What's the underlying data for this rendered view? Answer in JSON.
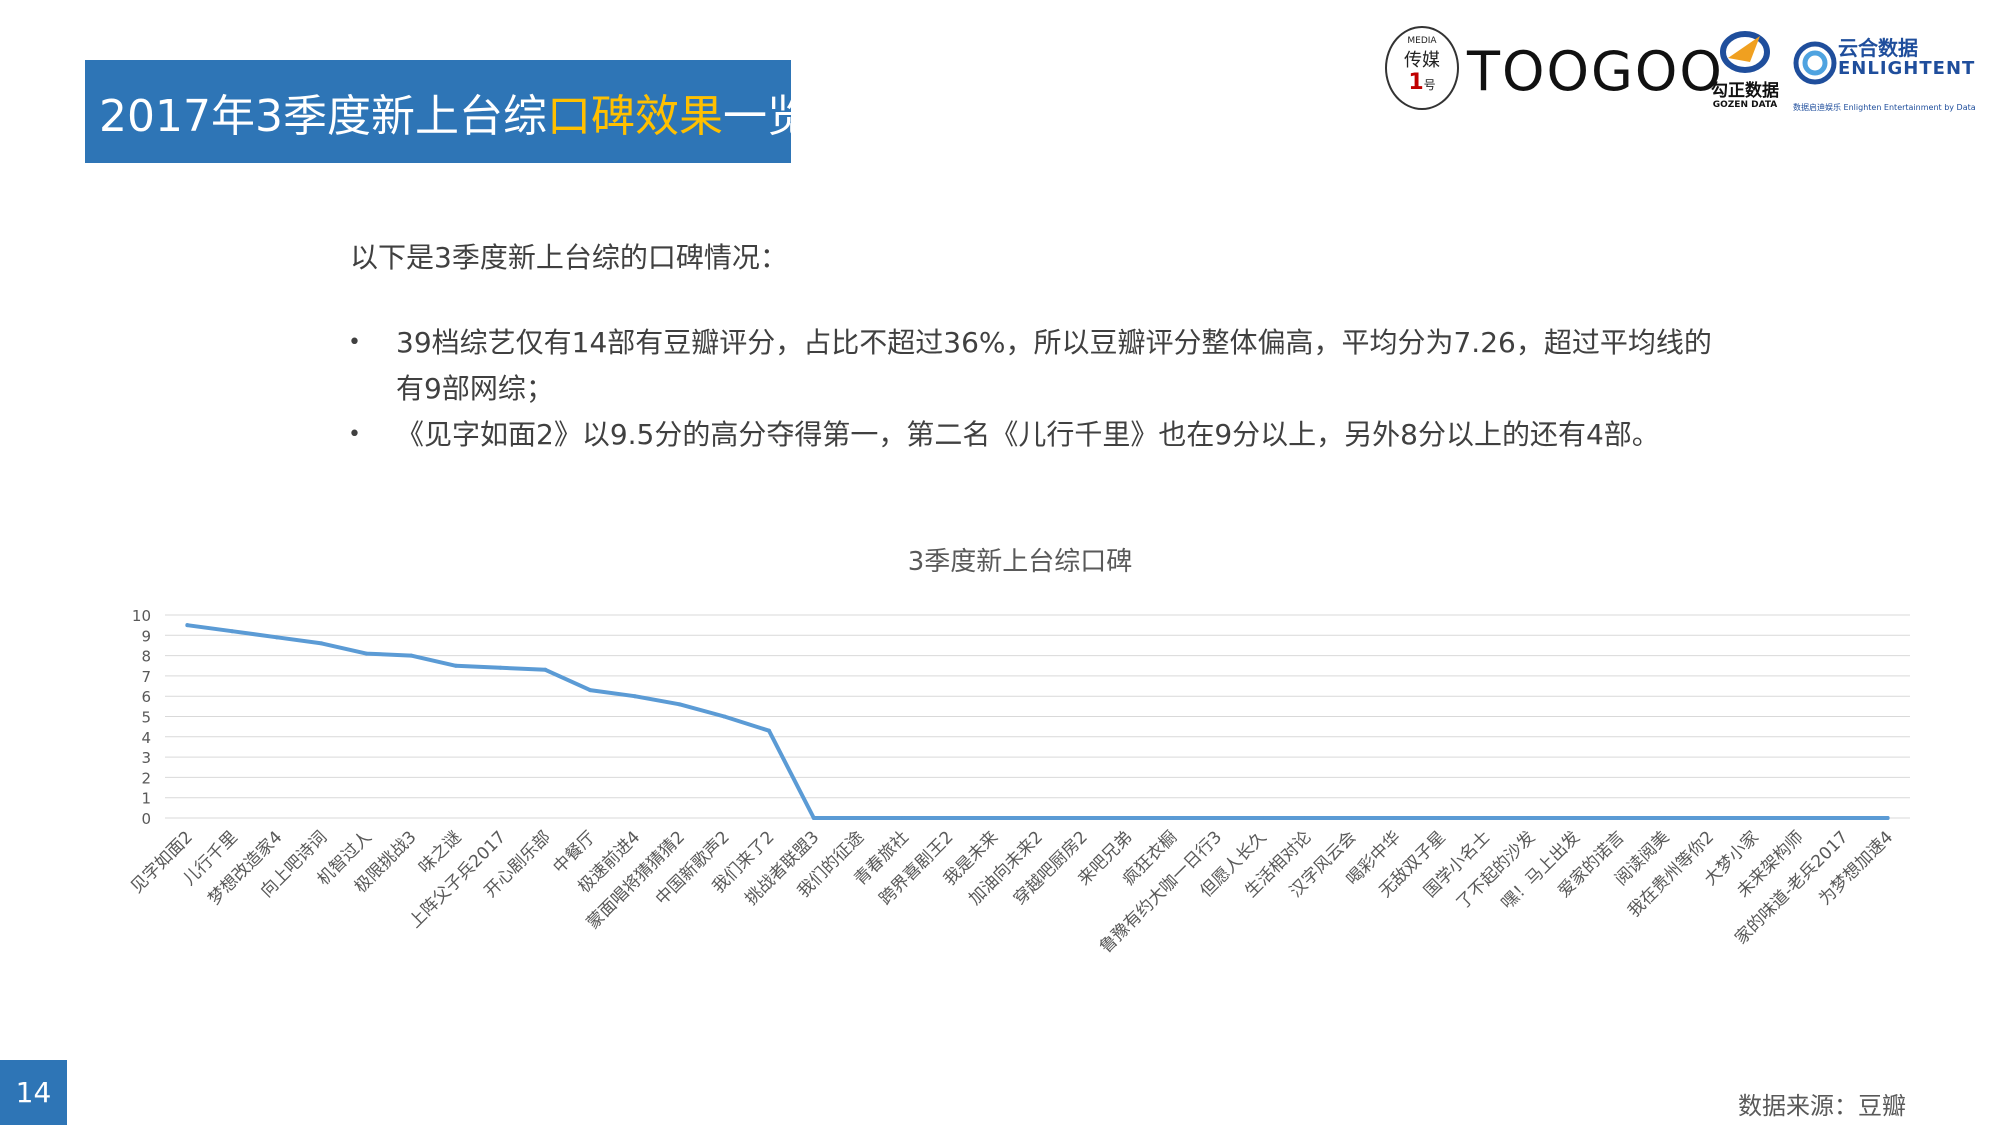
{
  "title": {
    "part1": "2017年3季度新上台综",
    "highlight": "口碑效果",
    "part2": "一览"
  },
  "logos": {
    "media_small": "MEDIA",
    "media_cn": "传媒",
    "media_num": "1",
    "media_hao": "号",
    "toogoo": "TOOGOO",
    "gozen_cn": "勾正数据",
    "gozen_en": "GOZEN DATA",
    "enlighten_cn": "云合数据",
    "enlighten_en": "ENLIGHTENT",
    "enlighten_sub": "数据启迪娱乐 Enlighten Entertainment by Data"
  },
  "intro": "以下是3季度新上台综的口碑情况：",
  "bullets": [
    {
      "marker": "•",
      "text": "39档综艺仅有14部有豆瓣评分，占比不超过36%，所以豆瓣评分整体偏高，平均分为7.26，超过平均线的有9部网综；"
    },
    {
      "marker": "•",
      "text": "《见字如面2》以9.5分的高分夺得第一，第二名《儿行千里》也在9分以上，另外8分以上的还有4部。"
    }
  ],
  "page_number": "14",
  "source": "数据来源：豆瓣",
  "colors": {
    "accent": "#2e75b6",
    "highlight": "#ffc000",
    "line": "#5b9bd5",
    "grid": "#d9d9d9"
  },
  "chart_data": {
    "type": "line",
    "title": "3季度新上台综口碑",
    "xlabel": "",
    "ylabel": "",
    "ylim": [
      0,
      10
    ],
    "yticks": [
      0,
      1,
      2,
      3,
      4,
      5,
      6,
      7,
      8,
      9,
      10
    ],
    "grid": true,
    "legend": "none",
    "categories": [
      "见字如面2",
      "儿行千里",
      "梦想改造家4",
      "向上吧诗词",
      "机智过人",
      "极限挑战3",
      "味之谜",
      "上阵父子兵2017",
      "开心剧乐部",
      "中餐厅",
      "极速前进4",
      "蒙面唱将猜猜猜2",
      "中国新歌声2",
      "我们来了2",
      "挑战者联盟3",
      "我们的征途",
      "青春旅社",
      "跨界喜剧王2",
      "我是未来",
      "加油向未来2",
      "穿越吧厨房2",
      "来吧兄弟",
      "疯狂衣橱",
      "鲁豫有约大咖一日行3",
      "但愿人长久",
      "生活相对论",
      "汉字风云会",
      "喝彩中华",
      "无敌双子星",
      "国学小名士",
      "了不起的沙发",
      "嘿！马上出发",
      "爱家的诺言",
      "阅读阅美",
      "我在贵州等你2",
      "大梦小家",
      "未来架构师",
      "家的味道-老兵2017",
      "为梦想加速4"
    ],
    "values": [
      9.5,
      9.2,
      8.9,
      8.6,
      8.1,
      8.0,
      7.5,
      7.4,
      7.3,
      6.3,
      6.0,
      5.6,
      5.0,
      4.3,
      0,
      0,
      0,
      0,
      0,
      0,
      0,
      0,
      0,
      0,
      0,
      0,
      0,
      0,
      0,
      0,
      0,
      0,
      0,
      0,
      0,
      0,
      0,
      0,
      0
    ]
  }
}
